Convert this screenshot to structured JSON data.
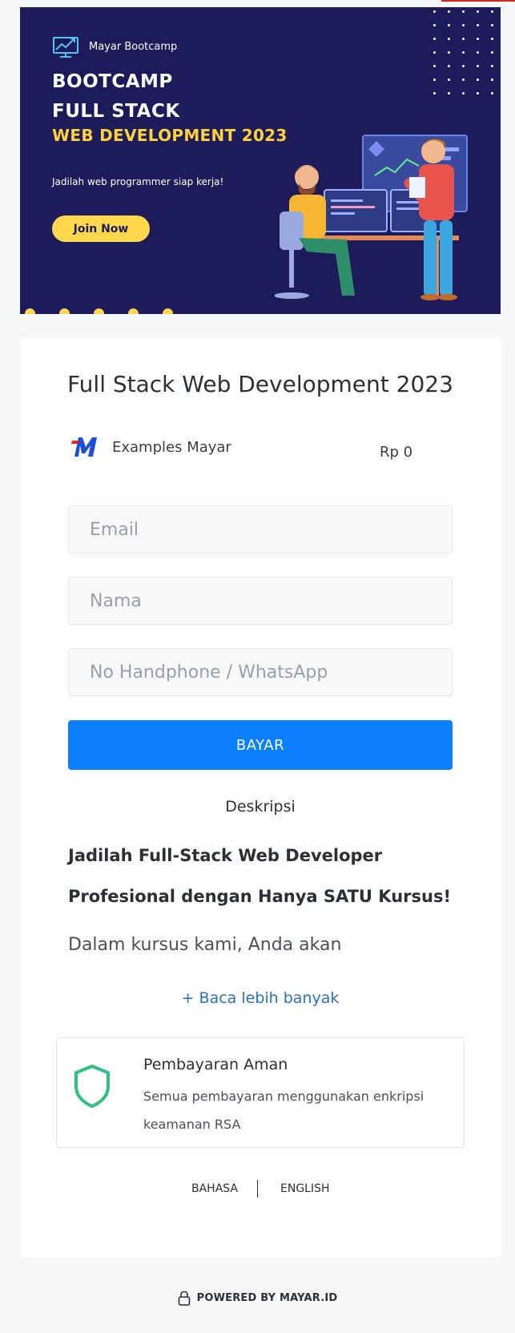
{
  "banner": {
    "brand_name": "Mayar Bootcamp",
    "headline_line1": "BOOTCAMP",
    "headline_line2": "FULL STACK",
    "headline_line3": "WEB DEVELOPMENT 2023",
    "tagline": "Jadilah web programmer siap kerja!",
    "cta_label": "Join Now",
    "colors": {
      "background": "#1d1b59",
      "accent": "#ffd84d"
    }
  },
  "product": {
    "title": "Full Stack Web Development 2023",
    "merchant_name": "Examples Mayar",
    "price": "Rp 0"
  },
  "form": {
    "email_placeholder": "Email",
    "name_placeholder": "Nama",
    "phone_placeholder": "No Handphone / WhatsApp",
    "submit_label": "BAYAR"
  },
  "description": {
    "heading": "Deskripsi",
    "bold_line1": "Jadilah Full-Stack Web Developer",
    "bold_line2": "Profesional dengan Hanya SATU Kursus!",
    "body_preview": "Dalam kursus kami, Anda akan",
    "read_more": "+ Baca lebih banyak"
  },
  "security": {
    "title": "Pembayaran Aman",
    "text": "Semua pembayaran menggunakan enkripsi keamanan RSA",
    "icon": "shield-icon"
  },
  "language": {
    "option1": "BAHASA",
    "option2": "ENGLISH"
  },
  "footer": {
    "powered_by": "POWERED BY MAYAR.ID",
    "icon": "lock-icon"
  },
  "colors": {
    "primary": "#0a80ff",
    "link": "#2b71b8",
    "shield": "#2ec27e"
  }
}
